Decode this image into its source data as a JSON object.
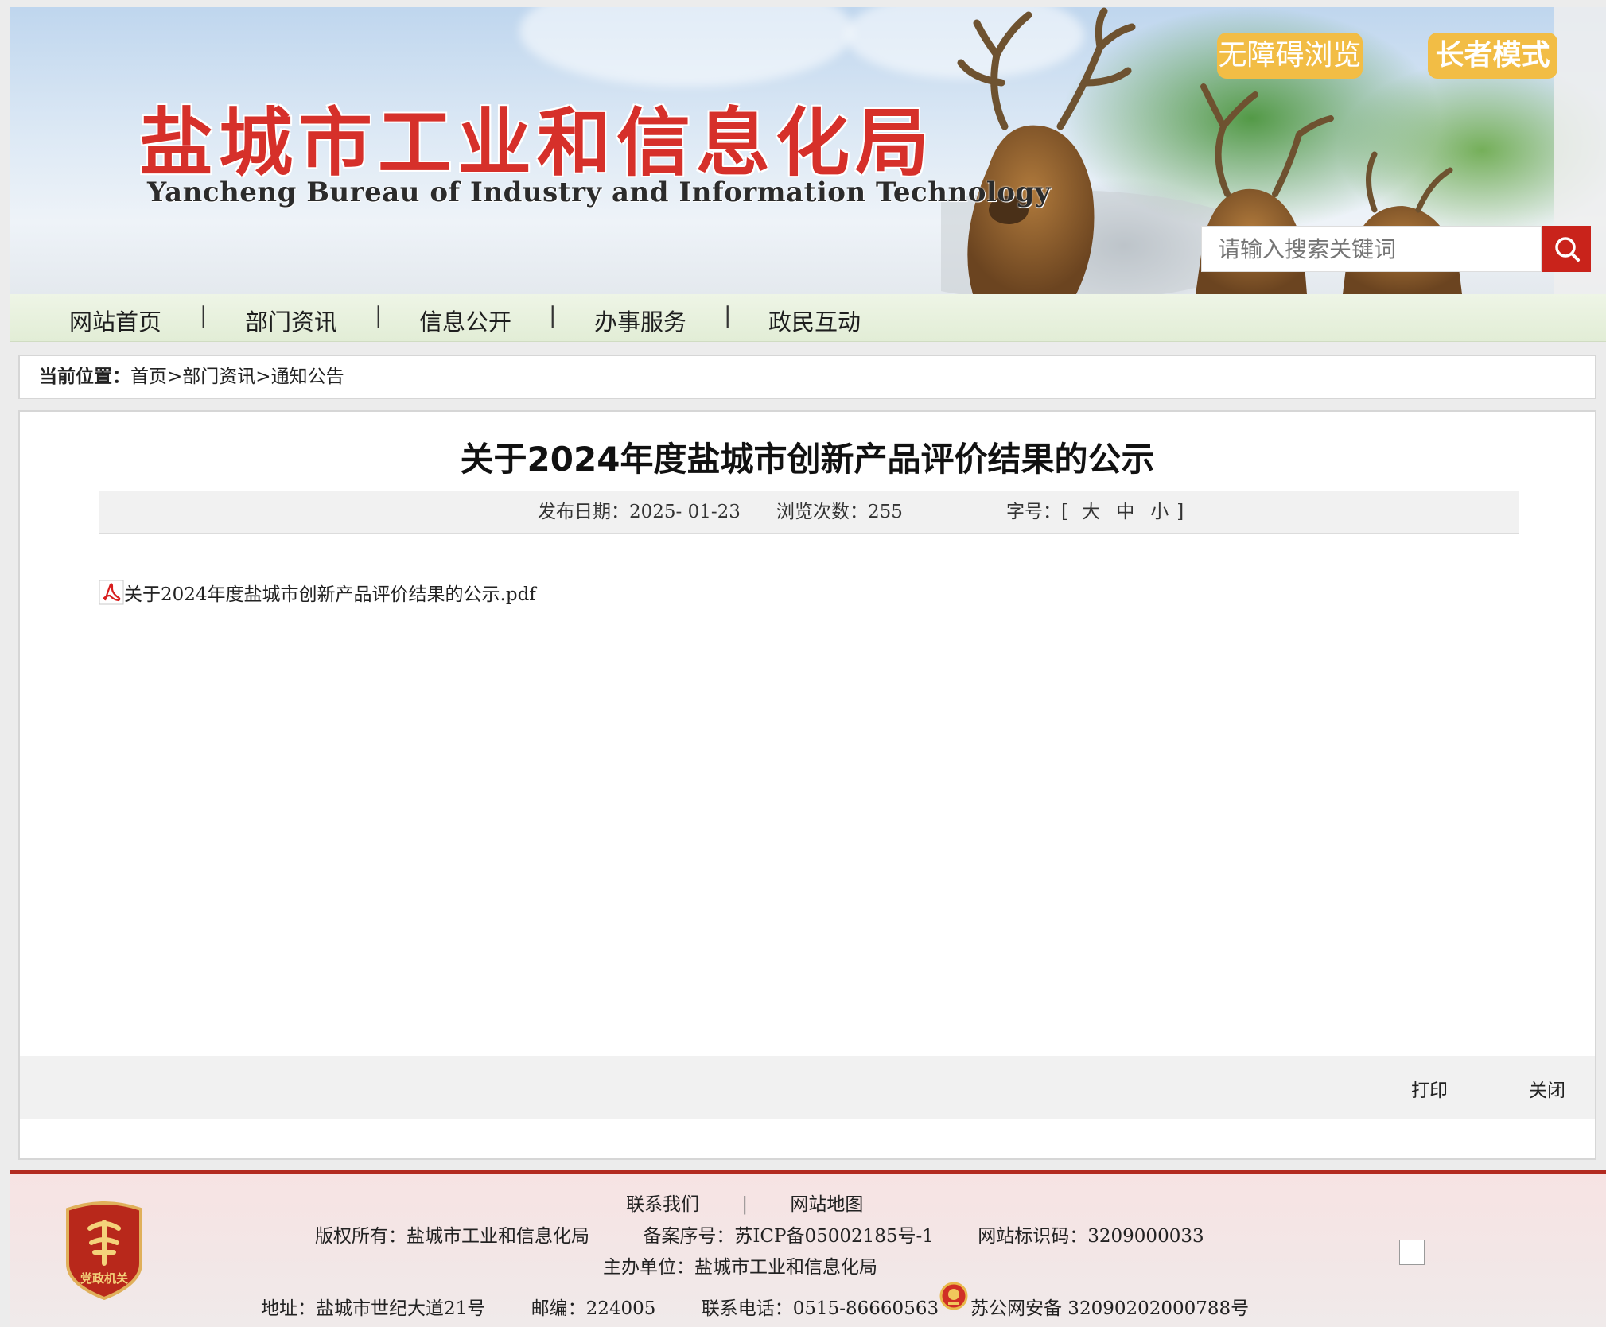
{
  "header": {
    "site_title": "盐城市工业和信息化局",
    "site_subtitle": "Yancheng Bureau of Industry and Information Technology",
    "accessibility_button": "无障碍浏览",
    "elder_mode_button": "长者模式",
    "search_placeholder": "请输入搜索关键词"
  },
  "nav": {
    "items": [
      "网站首页",
      "部门资讯",
      "信息公开",
      "办事服务",
      "政民互动"
    ],
    "separator": "|"
  },
  "breadcrumb": {
    "label": "当前位置：",
    "path": [
      "首页",
      "部门资讯",
      "通知公告"
    ],
    "separator": ">"
  },
  "article": {
    "title": "关于2024年度盐城市创新产品评价结果的公示",
    "publish_label": "发布日期：",
    "publish_date": "2025- 01-23",
    "views_label": "浏览次数：",
    "views": "255",
    "font_size_label": "字号：",
    "font_sizes": [
      "大",
      "中",
      "小"
    ],
    "attachment": "关于2024年度盐城市创新产品评价结果的公示.pdf",
    "print_label": "打印",
    "close_label": "关闭"
  },
  "footer": {
    "contact_us": "联系我们",
    "sitemap": "网站地图",
    "link_separator": "|",
    "copyright": "版权所有：盐城市工业和信息化局",
    "icp": "备案序号：苏ICP备05002185号-1",
    "site_code": "网站标识码：3209000033",
    "sponsor": "主办单位：盐城市工业和信息化局",
    "address": "地址：盐城市世纪大道21号",
    "postcode": "邮编：224005",
    "phone": "联系电话：0515-86660563",
    "police_record": "苏公网安备 32090202000788号",
    "party_badge_text": "党政机关"
  },
  "colors": {
    "title_red": "#d6302a",
    "mode_button": "#f2bd45",
    "search_button": "#c9231b",
    "footer_rule": "#b32a20"
  }
}
